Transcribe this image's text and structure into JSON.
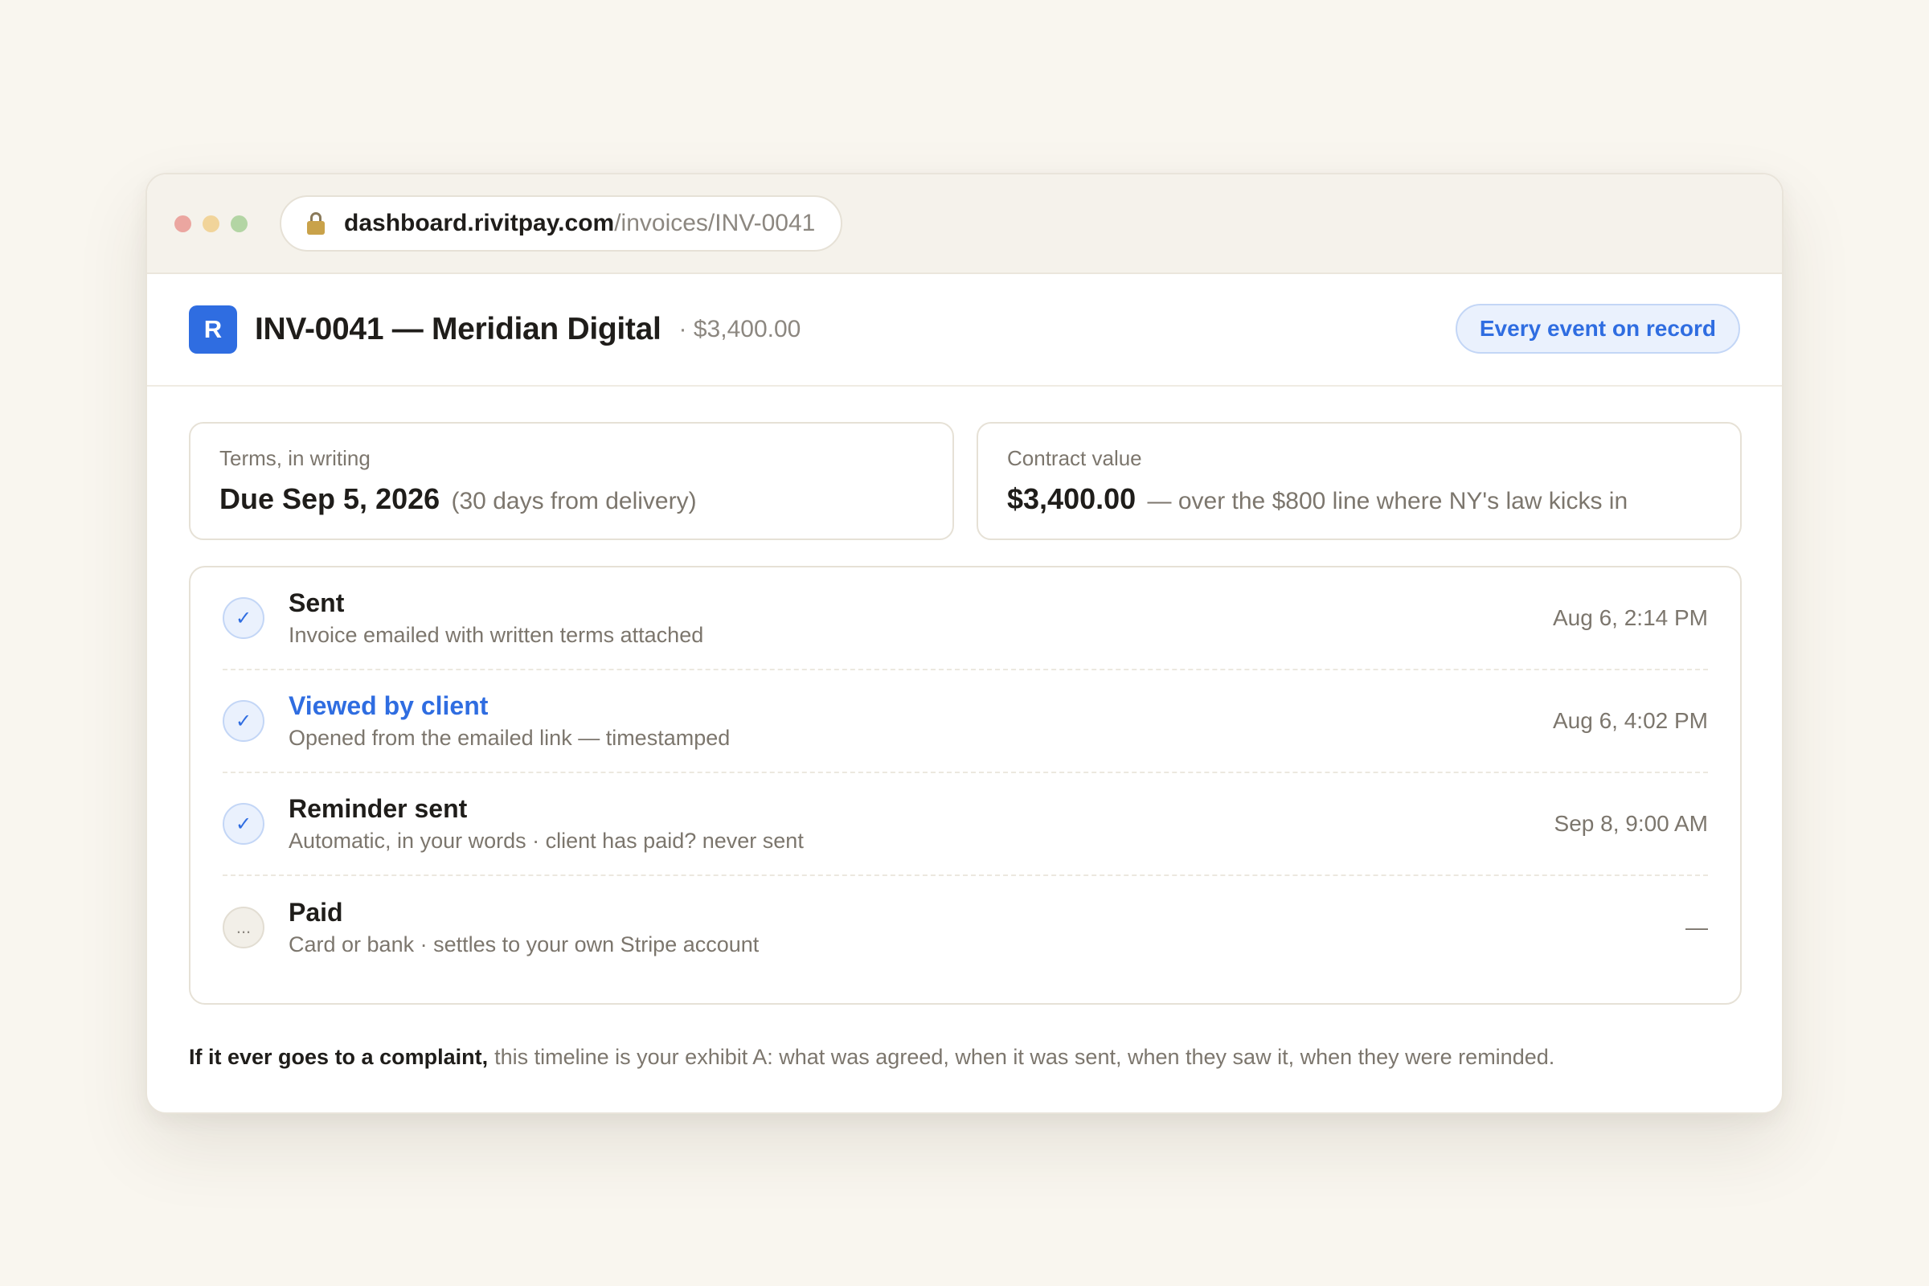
{
  "browser": {
    "url_host": "dashboard.rivitpay.com",
    "url_path": "/invoices/INV-0041"
  },
  "header": {
    "logo_letter": "R",
    "title": "INV-0041 — Meridian Digital",
    "amount": "· $3,400.00",
    "record_button": "Every event on record"
  },
  "cards": {
    "terms": {
      "label": "Terms, in writing",
      "value": "Due Sep 5, 2026",
      "note": "(30 days from delivery)"
    },
    "contract": {
      "label": "Contract value",
      "value": "$3,400.00",
      "note": "— over the $800 line where NY's law kicks in"
    }
  },
  "timeline": [
    {
      "title": "Sent",
      "desc": "Invoice emailed with written terms attached",
      "time": "Aug 6, 2:14 PM",
      "status": "done",
      "icon": "✓"
    },
    {
      "title": "Viewed by client",
      "desc": "Opened from the emailed link — timestamped",
      "time": "Aug 6, 4:02 PM",
      "status": "done",
      "icon": "✓"
    },
    {
      "title": "Reminder sent",
      "desc": "Automatic, in your words · client has paid? never sent",
      "time": "Sep 8, 9:00 AM",
      "status": "done",
      "icon": "✓"
    },
    {
      "title": "Paid",
      "desc": "Card or bank · settles to your own Stripe account",
      "time": "—",
      "status": "pending",
      "icon": "..."
    }
  ],
  "footer": {
    "lead": "If it ever goes to a complaint,",
    "text": "this timeline is your exhibit A: what was agreed, when it was sent, when they saw it, when they were reminded."
  },
  "colors": {
    "accent": "#2f6de1",
    "background": "#f9f6ef"
  }
}
